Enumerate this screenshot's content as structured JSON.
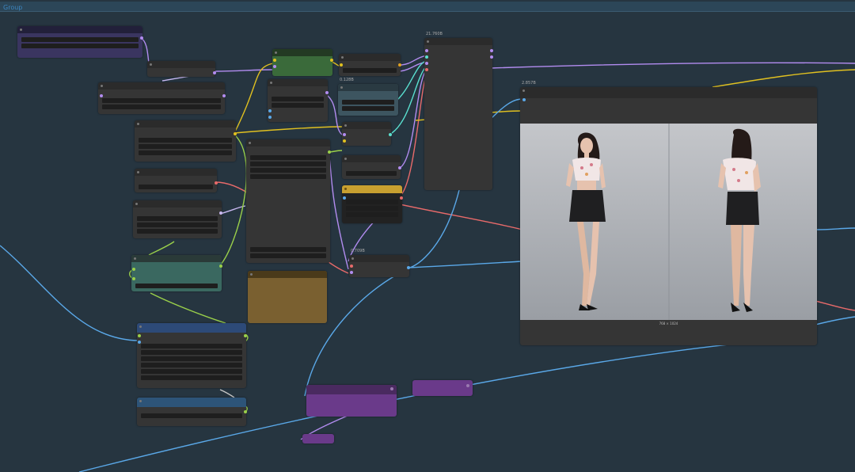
{
  "group": {
    "title": "Group"
  },
  "nodes": {
    "top_center": {
      "title": "21.760B"
    },
    "mid_a": {
      "title": "0.128B"
    },
    "lower_a": {
      "title": "0.709B"
    },
    "preview": {
      "title": "2.857B",
      "caption": "768 × 1024"
    }
  },
  "colors": {
    "background": "#263540",
    "node": "#353535",
    "field": "#1e1e1e",
    "wire_purple": "#b28cf0",
    "wire_yellow": "#e0c020",
    "wire_blue": "#5aa8e8",
    "wire_red": "#e86a6a",
    "wire_green": "#9ad04a",
    "wire_cyan": "#5ae0d0"
  },
  "image": {
    "description_icon": "preview-image"
  }
}
